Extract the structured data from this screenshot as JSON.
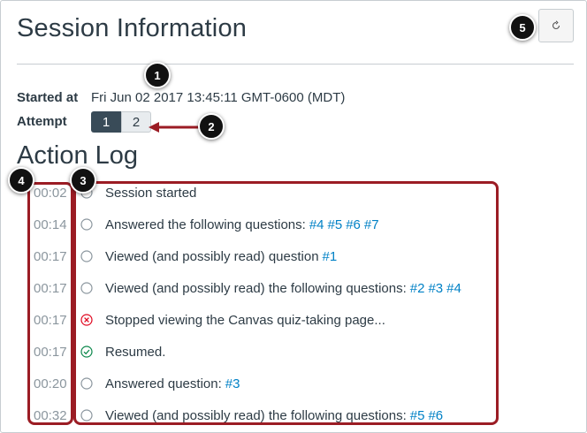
{
  "header": {
    "title": "Session Information",
    "refresh_icon": "refresh-icon"
  },
  "session": {
    "started_label": "Started at",
    "started_value": "Fri Jun 02 2017 13:45:11 GMT-0600 (MDT)",
    "attempt_label": "Attempt",
    "attempts": [
      "1",
      "2"
    ],
    "active_attempt": "1"
  },
  "log": {
    "heading": "Action Log",
    "entries": [
      {
        "time": "00:02",
        "status": "neutral",
        "text": "Session started",
        "links": []
      },
      {
        "time": "00:14",
        "status": "neutral",
        "text": "Answered the following questions:",
        "links": [
          "#4",
          "#5",
          "#6",
          "#7"
        ]
      },
      {
        "time": "00:17",
        "status": "neutral",
        "text": "Viewed (and possibly read) question",
        "links": [
          "#1"
        ]
      },
      {
        "time": "00:17",
        "status": "neutral",
        "text": "Viewed (and possibly read) the following questions:",
        "links": [
          "#2",
          "#3",
          "#4"
        ]
      },
      {
        "time": "00:17",
        "status": "error",
        "text": "Stopped viewing the Canvas quiz-taking page...",
        "links": []
      },
      {
        "time": "00:17",
        "status": "success",
        "text": "Resumed.",
        "links": []
      },
      {
        "time": "00:20",
        "status": "neutral",
        "text": "Answered question:",
        "links": [
          "#3"
        ]
      },
      {
        "time": "00:32",
        "status": "neutral",
        "text": "Viewed (and possibly read) the following questions:",
        "links": [
          "#5",
          "#6"
        ]
      }
    ]
  },
  "callouts": [
    "1",
    "2",
    "3",
    "4",
    "5"
  ],
  "colors": {
    "callout_red": "#9b1c24",
    "link_blue": "#0081c6",
    "error_red": "#e0061f",
    "success_green": "#0b874b"
  }
}
